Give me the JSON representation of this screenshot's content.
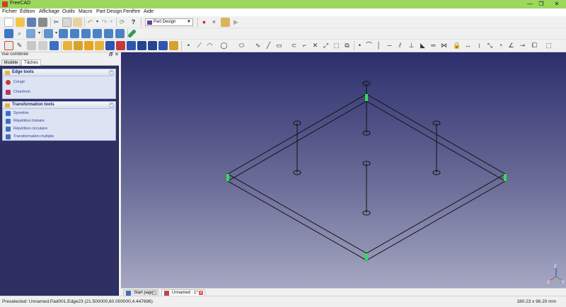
{
  "window": {
    "title": "FreeCAD",
    "minimize_glyph": "—",
    "maximize_glyph": "❐",
    "close_glyph": "✕",
    "titlebar_color": "#9bd85b"
  },
  "menu": {
    "items": [
      "Fichier",
      "Édition",
      "Affichage",
      "Outils",
      "Macro",
      "Part Design",
      "Fenêtre",
      "Aide"
    ]
  },
  "toolbar": {
    "workbench": "Part Design",
    "record_macro_glyph": "●",
    "stop_macro_glyph": "■",
    "run_macro_glyph": "▶"
  },
  "combo_view": {
    "title": "Vue combinée",
    "float_glyph": "🗗",
    "close_glyph": "✕",
    "tabs": [
      {
        "label": "Modèle",
        "active": false
      },
      {
        "label": "Tâches",
        "active": true
      }
    ]
  },
  "task_panel": {
    "edge_tools": {
      "title": "Edge tools",
      "collapse_glyph": "«",
      "items": [
        {
          "label": "Congé",
          "icon": "fillet-icon"
        },
        {
          "label": "Chanfrein",
          "icon": "chamfer-icon"
        }
      ]
    },
    "transformation_tools": {
      "title": "Transformation tools",
      "collapse_glyph": "«",
      "items": [
        {
          "label": "Symétrie",
          "icon": "mirror-icon"
        },
        {
          "label": "Répétition linéaire",
          "icon": "linear-pattern-icon"
        },
        {
          "label": "Répétition circulaire",
          "icon": "polar-pattern-icon"
        },
        {
          "label": "Transformation multiple",
          "icon": "multi-transform-icon"
        }
      ]
    }
  },
  "viewport": {
    "axis_labels": {
      "x": "X",
      "y": "Y",
      "z": "Z"
    },
    "background_top": "#2c2e6d",
    "background_bottom": "#a5a7c2",
    "edge_color": "#111111",
    "selected_vertex_color": "#33dd55"
  },
  "document_tabs": [
    {
      "label": "Start page",
      "active": false,
      "close_glyph": "▫"
    },
    {
      "label": "Unnamed : 1*",
      "active": true,
      "close_glyph": "✕"
    }
  ],
  "status": {
    "message": "Preselected: Unnamed.Pad001.Edge23 (21.500000,60.000000,4.447896)",
    "dimensions": "180.23 x 96.20 mm"
  }
}
